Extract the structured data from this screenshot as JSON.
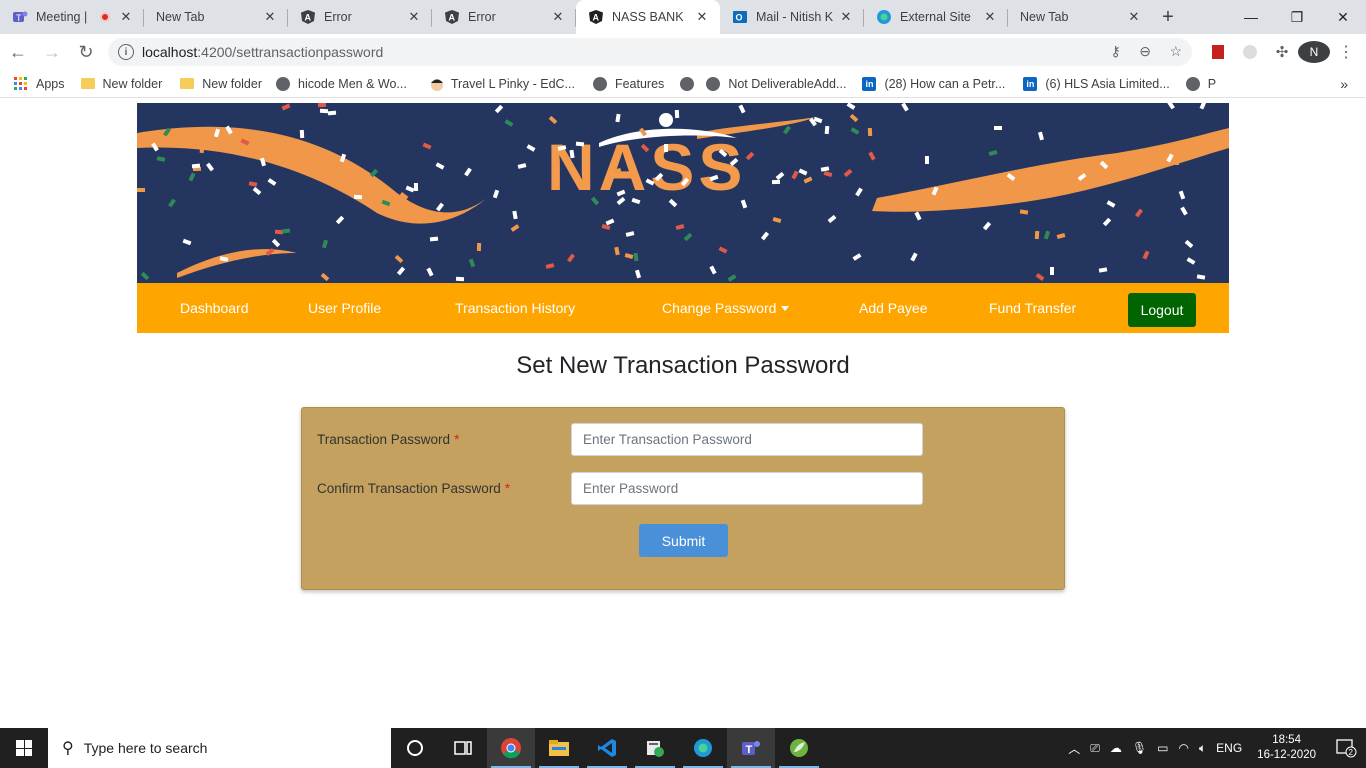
{
  "browser": {
    "tabs": [
      {
        "title": "Meeting |",
        "icon": "teams-icon",
        "recording": true
      },
      {
        "title": "New Tab",
        "icon": ""
      },
      {
        "title": "Error",
        "icon": "angular-icon"
      },
      {
        "title": "Error",
        "icon": "angular-icon"
      },
      {
        "title": "NASS BANK",
        "icon": "angular-icon",
        "active": true
      },
      {
        "title": "Mail - Nitish K",
        "icon": "outlook-icon"
      },
      {
        "title": "External Site",
        "icon": "edge-icon"
      },
      {
        "title": "New Tab",
        "icon": ""
      }
    ],
    "url_host": "localhost",
    "url_path": ":4200/settransactionpassword",
    "profile_initial": "N",
    "bookmarks": [
      {
        "label": "Apps",
        "icon": "apps-icon"
      },
      {
        "label": "New folder",
        "icon": "folder-icon"
      },
      {
        "label": "New folder",
        "icon": "folder-icon"
      },
      {
        "label": "hicode Men & Wo...",
        "icon": "globe-icon"
      },
      {
        "label": "Travel L Pinky - EdC...",
        "icon": "avatar-icon"
      },
      {
        "label": "Features",
        "icon": "globe-icon"
      },
      {
        "label": "",
        "icon": "globe-icon"
      },
      {
        "label": "Not DeliverableAdd...",
        "icon": "globe-icon"
      },
      {
        "label": "(28) How can a Petr...",
        "icon": "linkedin-icon"
      },
      {
        "label": "(6) HLS Asia Limited...",
        "icon": "linkedin-icon"
      },
      {
        "label": "P",
        "icon": "globe-icon"
      }
    ]
  },
  "site": {
    "logo_text": "NASS",
    "nav": {
      "dashboard": "Dashboard",
      "user_profile": "User Profile",
      "transaction_history": "Transaction History",
      "change_password": "Change Password",
      "add_payee": "Add Payee",
      "fund_transfer": "Fund Transfer",
      "logout": "Logout"
    },
    "page_title": "Set New Transaction Password",
    "form": {
      "field1_label": "Transaction Password",
      "field1_placeholder": "Enter Transaction Password",
      "field2_label": "Confirm Transaction Password",
      "field2_placeholder": "Enter Password",
      "required_marker": "*",
      "submit_label": "Submit"
    },
    "colors": {
      "banner_bg": "#243660",
      "navbar_bg": "#ffa500",
      "logout_bg": "#006400",
      "card_bg": "#c4a15e",
      "submit_bg": "#4a90d9"
    }
  },
  "taskbar": {
    "search_placeholder": "Type here to search",
    "language": "ENG",
    "time": "18:54",
    "date": "16-12-2020",
    "notification_count": "2"
  }
}
